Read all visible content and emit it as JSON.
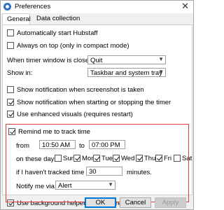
{
  "window": {
    "title": "Preferences"
  },
  "tabs": [
    {
      "label": "General"
    },
    {
      "label": "Data collection"
    }
  ],
  "general": {
    "auto_start": "Automatically start Hubstaff",
    "always_on_top": "Always on top (only in compact mode)",
    "timer_closed_label": "When timer window is closed:",
    "timer_closed_value": "Quit",
    "show_in_label": "Show in:",
    "show_in_value": "Taskbar and system tray",
    "notify_screenshot": "Show notification when screenshot is taken",
    "notify_start_stop": "Show notification when starting or stopping the timer",
    "enhanced_visuals": "Use enhanced visuals (requires restart)",
    "remind_track": "Remind me to track time",
    "from_label": "from",
    "from_value": "10:50 AM",
    "to_label": "to",
    "to_value": "07:00 PM",
    "days_label": "on these days:",
    "days": [
      "Sun",
      "Mon",
      "Tue",
      "Wed",
      "Thu",
      "Fri",
      "Sat"
    ],
    "days_checked": [
      false,
      true,
      true,
      true,
      true,
      true,
      false
    ],
    "not_tracked_label": "if I haven't tracked time in",
    "not_tracked_value": "30",
    "minutes_label": "minutes.",
    "notify_via_label": "Notify me via",
    "notify_via_value": "Alert",
    "background_helper": "Use background helper (requires restart)",
    "checked": {
      "auto_start": false,
      "always_on_top": false,
      "notify_screenshot": false,
      "notify_start_stop": true,
      "enhanced_visuals": true,
      "remind_track": true,
      "background_helper": true
    }
  },
  "buttons": {
    "ok": "OK",
    "cancel": "Cancel",
    "apply": "Apply"
  }
}
